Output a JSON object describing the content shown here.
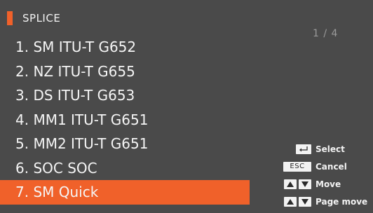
{
  "header": {
    "title": "SPLICE",
    "page": "1 / 4"
  },
  "menu": {
    "items": [
      {
        "label": "1. SM ITU-T G652"
      },
      {
        "label": "2. NZ ITU-T G655"
      },
      {
        "label": "3. DS ITU-T G653"
      },
      {
        "label": "4. MM1 ITU-T G651"
      },
      {
        "label": "5. MM2 ITU-T G651"
      },
      {
        "label": "6. SOC SOC"
      },
      {
        "label": "7. SM Quick"
      }
    ],
    "selected_index": 6
  },
  "help": {
    "select_label": "Select",
    "esc_key": "ESC",
    "cancel_label": "Cancel",
    "move_label": "Move",
    "page_move_label": "Page move"
  },
  "colors": {
    "accent": "#f0612a",
    "background": "#4a4a4a"
  }
}
